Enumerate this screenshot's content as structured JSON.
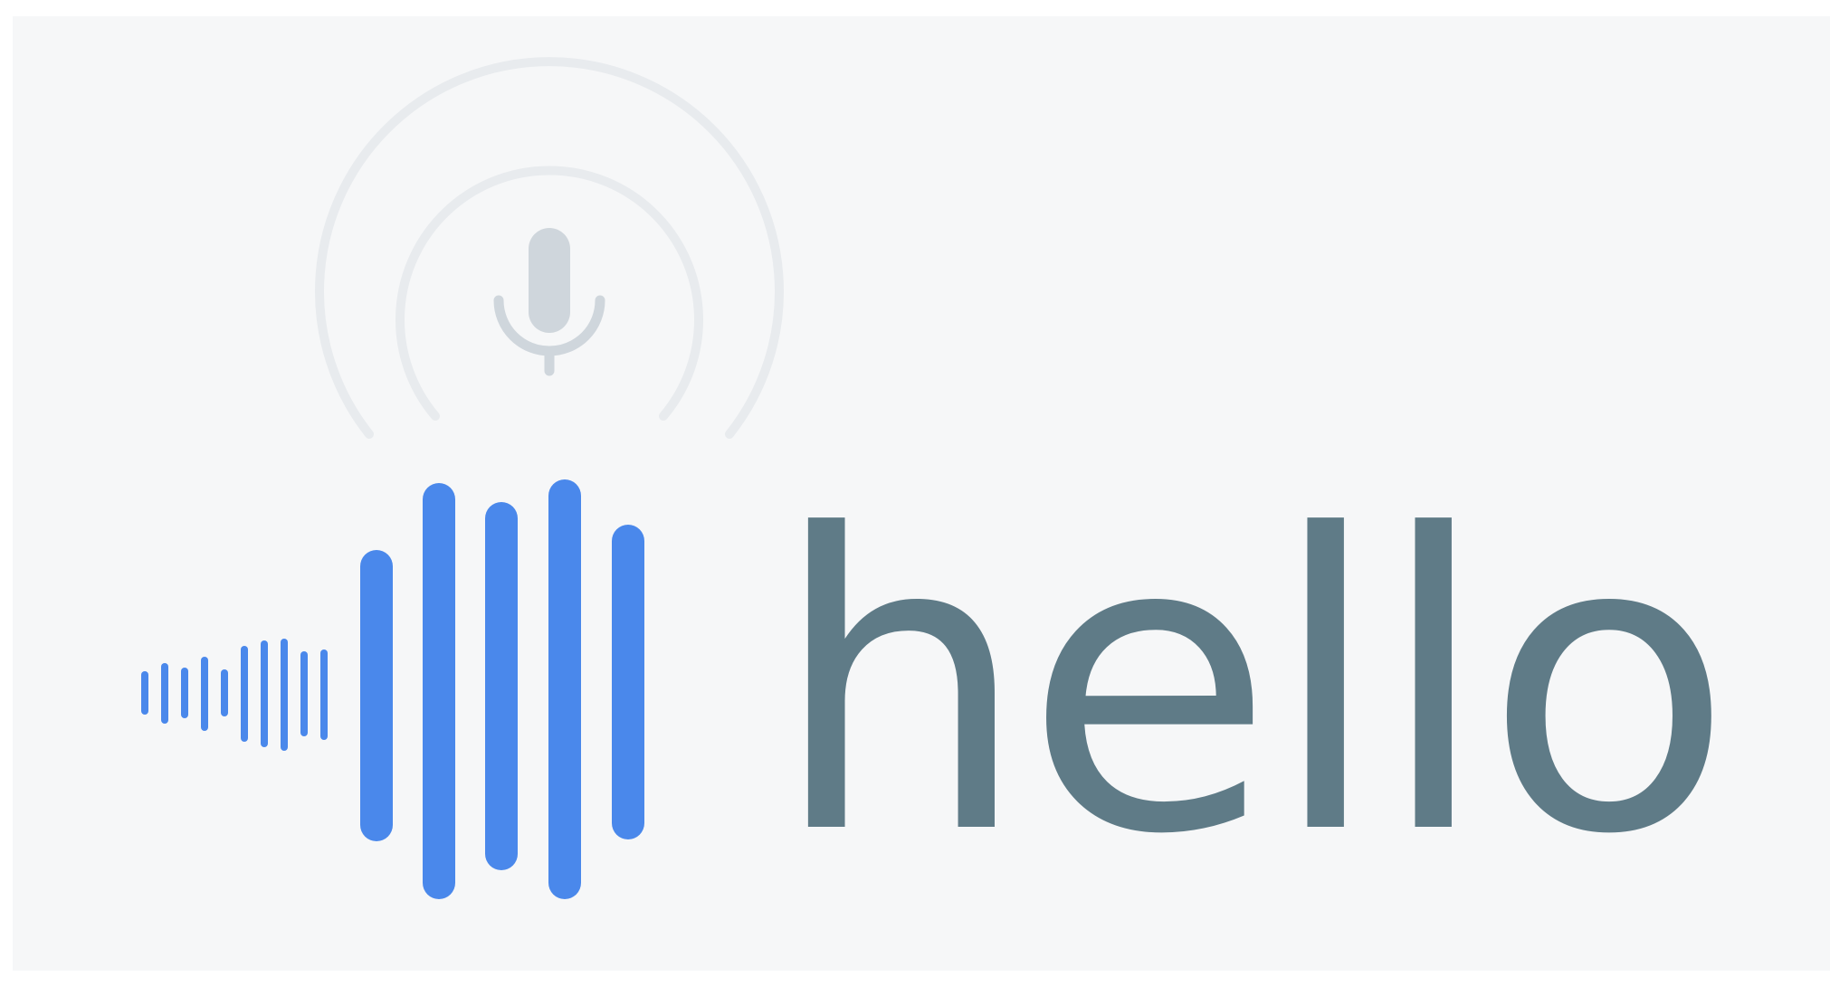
{
  "graphic": {
    "word": "hello",
    "colors": {
      "background": "#f6f7f8",
      "wave_bars": "#4a88eb",
      "word_text": "#5f7b87",
      "mic": "#cfd6dc",
      "rings": "#e8ebee"
    },
    "icons": {
      "microphone": "microphone-icon",
      "sound_wave": "sound-wave-icon"
    }
  }
}
